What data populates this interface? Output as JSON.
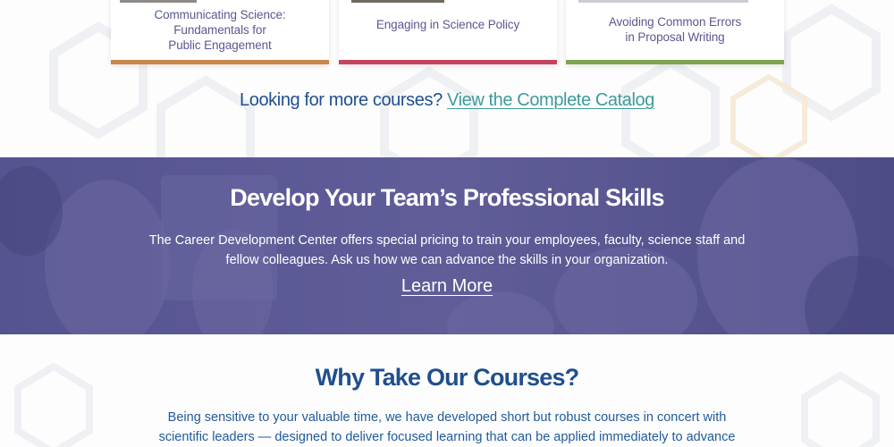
{
  "colors": {
    "card1_accent": "#c9874a",
    "card2_accent": "#c4455c",
    "card3_accent": "#7ea54f",
    "band_purple": "#5a5894",
    "heading_blue": "#1f4f8f",
    "link_teal": "#3f9a9a"
  },
  "courses": [
    {
      "title_lines": [
        "Communicating Science:",
        "Fundamentals for",
        "Public Engagement"
      ]
    },
    {
      "title_lines": [
        "Engaging in Science Policy"
      ]
    },
    {
      "title_lines": [
        "Avoiding Common Errors",
        "in Proposal Writing"
      ]
    }
  ],
  "more_courses": {
    "lead": "Looking for more courses?",
    "link": "View the Complete Catalog"
  },
  "team": {
    "heading": "Develop Your Team’s Professional Skills",
    "body": "The Career Development Center offers special pricing to train your employees, faculty, science staff and fellow colleagues. Ask us how we can advance the skills in your organization.",
    "cta": "Learn More"
  },
  "why": {
    "heading": "Why Take Our Courses?",
    "body": "Being sensitive to your valuable time, we have developed short but robust courses in concert with scientific leaders — designed to deliver focused learning that can be applied immediately to advance"
  }
}
